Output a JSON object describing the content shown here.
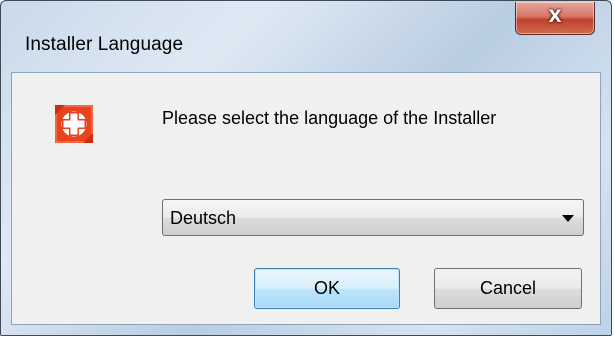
{
  "window": {
    "title": "Installer Language",
    "close_label": "X"
  },
  "dialog": {
    "icon": "red-swiss-cross-icon",
    "prompt": "Please select the language of the Installer",
    "language_select": {
      "selected": "Deutsch"
    },
    "buttons": {
      "ok": "OK",
      "cancel": "Cancel"
    }
  },
  "colors": {
    "icon_red": "#e8421f",
    "close_button": "#c7503d",
    "ok_button_border": "#3c7fb1"
  }
}
